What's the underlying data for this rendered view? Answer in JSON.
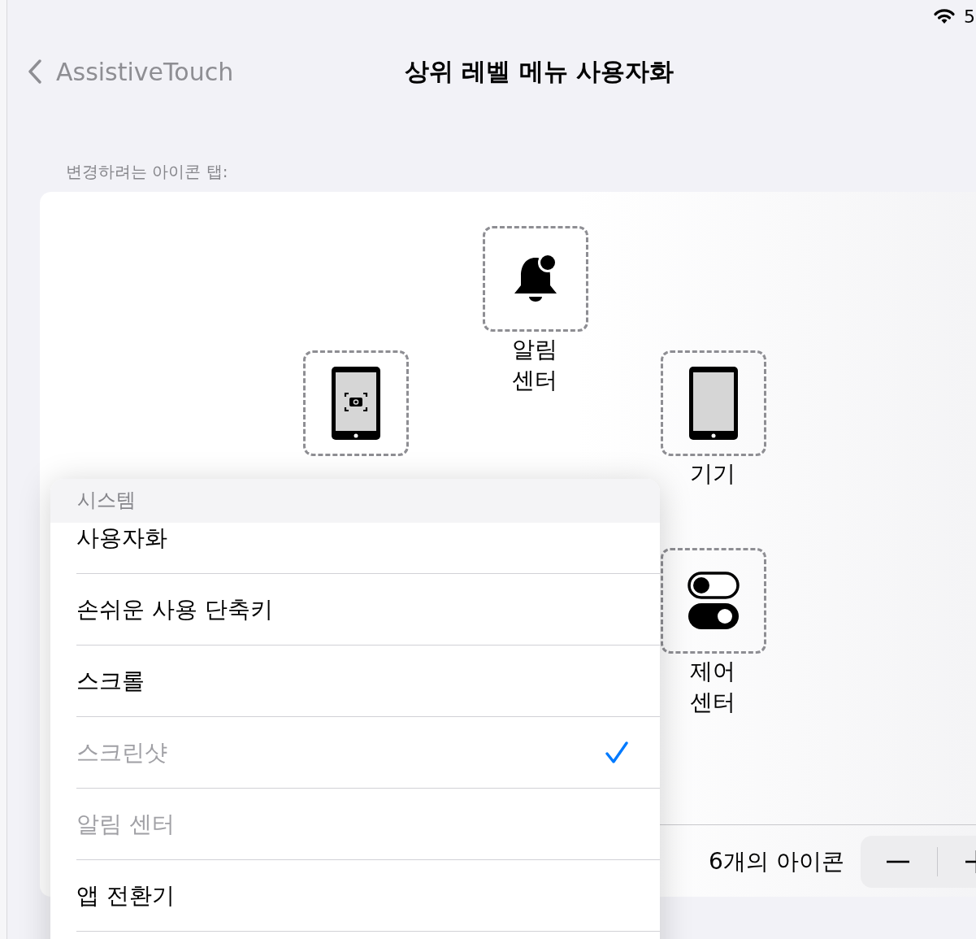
{
  "status_bar": {
    "battery": "5"
  },
  "nav": {
    "back": "AssistiveTouch",
    "title": "상위 레벨 메뉴 사용자화"
  },
  "section_label": "변경하려는 아이콘 탭:",
  "slots": [
    {
      "kind": "bell",
      "label": "알림 센터"
    },
    {
      "kind": "screenshot"
    },
    {
      "kind": "device",
      "label": "기기"
    },
    {
      "kind": "toggles",
      "label": "제어 센터"
    }
  ],
  "popover": {
    "header": "시스템",
    "items": [
      {
        "label": "사용자화",
        "disabled": false,
        "selected": false
      },
      {
        "label": "손쉬운 사용 단축키",
        "disabled": false,
        "selected": false
      },
      {
        "label": "스크롤",
        "disabled": false,
        "selected": false
      },
      {
        "label": "스크린샷",
        "disabled": true,
        "selected": true
      },
      {
        "label": "알림 센터",
        "disabled": true,
        "selected": false
      },
      {
        "label": "앱 전환기",
        "disabled": false,
        "selected": false
      }
    ]
  },
  "footer": {
    "count": "6개의 아이콘"
  }
}
